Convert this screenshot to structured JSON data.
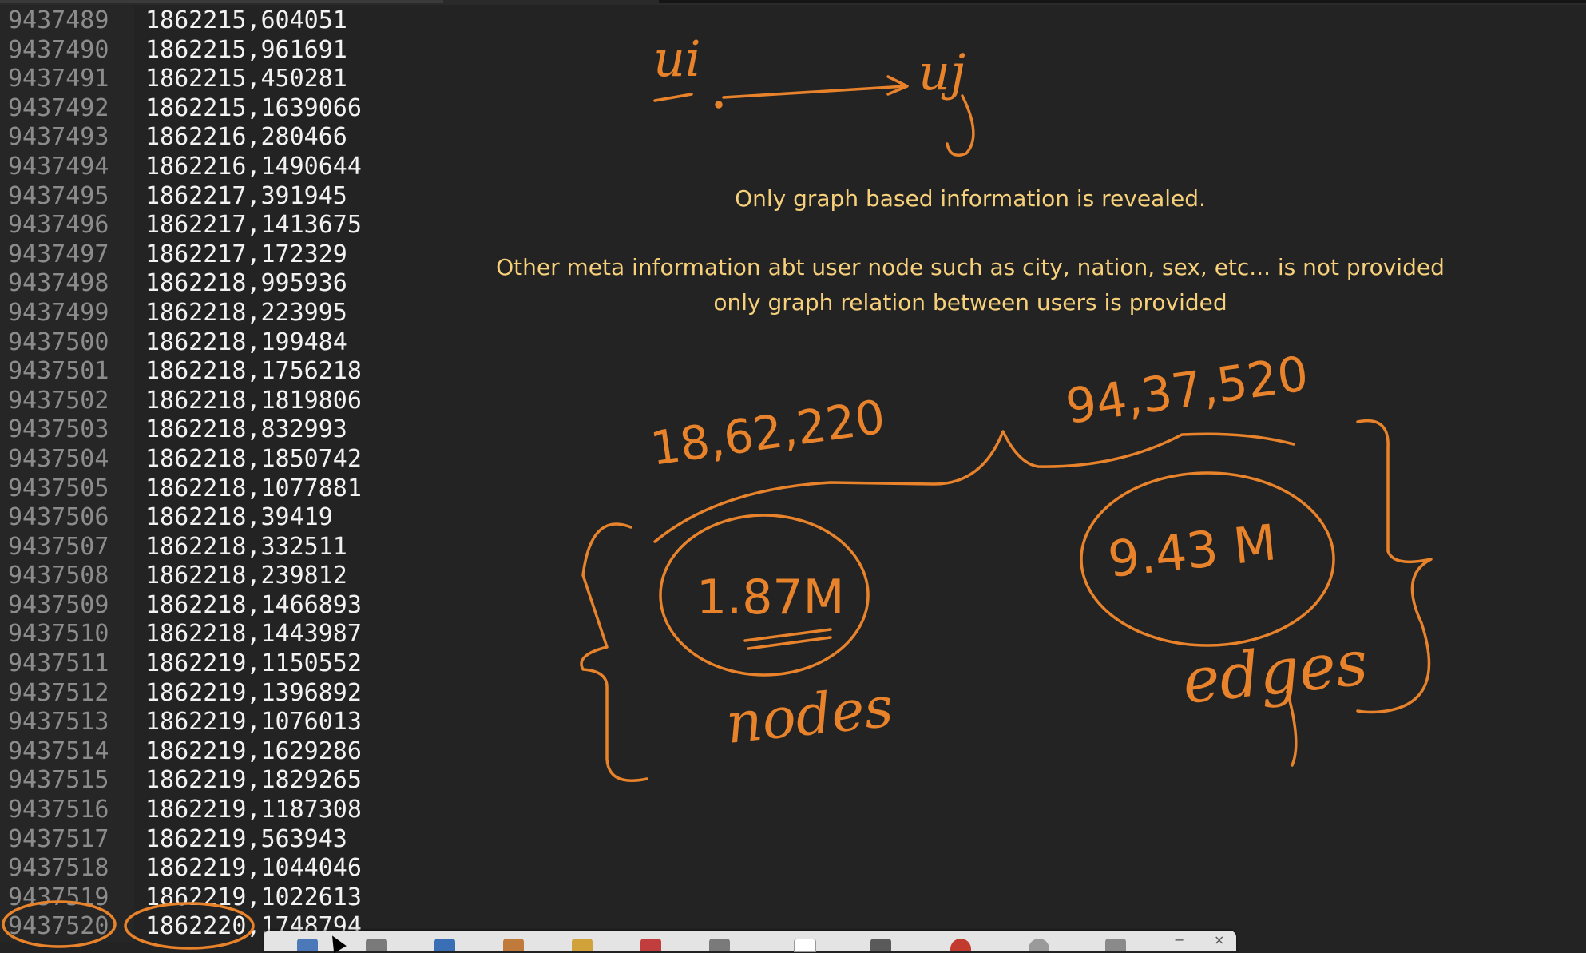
{
  "editor": {
    "rows": [
      {
        "n": "9437489",
        "t": "1862215,604051"
      },
      {
        "n": "9437490",
        "t": "1862215,961691"
      },
      {
        "n": "9437491",
        "t": "1862215,450281"
      },
      {
        "n": "9437492",
        "t": "1862215,1639066"
      },
      {
        "n": "9437493",
        "t": "1862216,280466"
      },
      {
        "n": "9437494",
        "t": "1862216,1490644"
      },
      {
        "n": "9437495",
        "t": "1862217,391945"
      },
      {
        "n": "9437496",
        "t": "1862217,1413675"
      },
      {
        "n": "9437497",
        "t": "1862217,172329"
      },
      {
        "n": "9437498",
        "t": "1862218,995936"
      },
      {
        "n": "9437499",
        "t": "1862218,223995"
      },
      {
        "n": "9437500",
        "t": "1862218,199484"
      },
      {
        "n": "9437501",
        "t": "1862218,1756218"
      },
      {
        "n": "9437502",
        "t": "1862218,1819806"
      },
      {
        "n": "9437503",
        "t": "1862218,832993"
      },
      {
        "n": "9437504",
        "t": "1862218,1850742"
      },
      {
        "n": "9437505",
        "t": "1862218,1077881"
      },
      {
        "n": "9437506",
        "t": "1862218,39419"
      },
      {
        "n": "9437507",
        "t": "1862218,332511"
      },
      {
        "n": "9437508",
        "t": "1862218,239812"
      },
      {
        "n": "9437509",
        "t": "1862218,1466893"
      },
      {
        "n": "9437510",
        "t": "1862218,1443987"
      },
      {
        "n": "9437511",
        "t": "1862219,1150552"
      },
      {
        "n": "9437512",
        "t": "1862219,1396892"
      },
      {
        "n": "9437513",
        "t": "1862219,1076013"
      },
      {
        "n": "9437514",
        "t": "1862219,1629286"
      },
      {
        "n": "9437515",
        "t": "1862219,1829265"
      },
      {
        "n": "9437516",
        "t": "1862219,1187308"
      },
      {
        "n": "9437517",
        "t": "1862219,563943"
      },
      {
        "n": "9437518",
        "t": "1862219,1044046"
      },
      {
        "n": "9437519",
        "t": "1862219,1022613"
      },
      {
        "n": "9437520",
        "t": "1862220,1748794"
      }
    ]
  },
  "notes": {
    "line1": "Only graph based information is revealed.",
    "line2": "Other meta information abt user node such as city, nation, sex, etc... is not provided",
    "line3": "only graph relation between users is provided"
  },
  "annotations": {
    "ui": "ui",
    "uj": "uj",
    "node_count": "18,62,220",
    "edge_count": "94,37,520",
    "nodes_approx": "1.87M",
    "edges_approx": "9.43 M",
    "nodes_label": "nodes",
    "edges_label": "edges"
  },
  "colors": {
    "ink": "#e8832b",
    "note": "#f6d07a",
    "background": "#232323"
  },
  "dock": {
    "tools": [
      "eraser-icon",
      "screen-icon",
      "pen-icon",
      "marker-icon",
      "pencil-icon",
      "highlighter-icon",
      "arrow-icon",
      "rectangle-icon",
      "line-icon",
      "color-icon",
      "zoom-icon",
      "settings-icon"
    ],
    "minimize": "−",
    "close": "×"
  }
}
